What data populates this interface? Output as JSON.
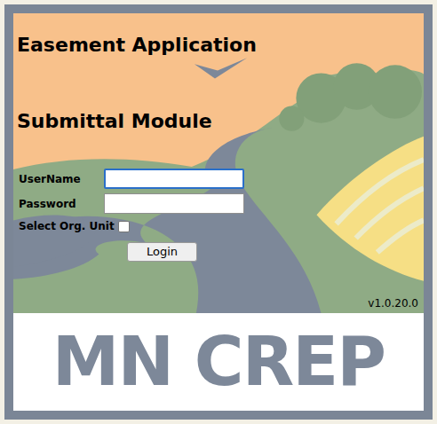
{
  "title": "Easement Application",
  "subtitle": "Submittal Module",
  "form": {
    "fields": [
      {
        "label": "UserName",
        "value": "",
        "focused": true
      },
      {
        "label": "Password",
        "value": "",
        "focused": false
      }
    ],
    "checkbox": {
      "label": "Select Org. Unit",
      "checked": false
    },
    "button": "Login"
  },
  "version": "v1.0.20.0",
  "logo": "MN CREP"
}
